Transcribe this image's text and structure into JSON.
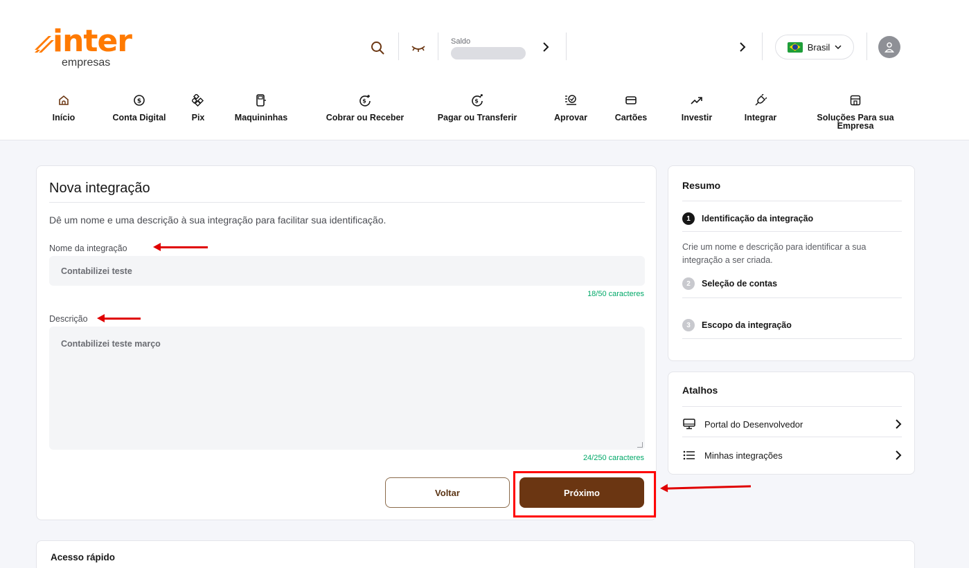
{
  "brand": {
    "name": "inter",
    "sub": "empresas",
    "color": "#ff7a00"
  },
  "topbar": {
    "saldo_label": "Saldo",
    "country": "Brasil"
  },
  "nav": [
    {
      "label": "Início",
      "icon": "home-icon"
    },
    {
      "label": "Conta Digital",
      "icon": "dollar-circle-icon"
    },
    {
      "label": "Pix",
      "icon": "pix-icon"
    },
    {
      "label": "Maquininhas",
      "icon": "card-machine-icon"
    },
    {
      "label": "Cobrar ou Receber",
      "icon": "receive-money-icon"
    },
    {
      "label": "Pagar ou Transferir",
      "icon": "pay-money-icon"
    },
    {
      "label": "Aprovar",
      "icon": "approve-icon"
    },
    {
      "label": "Cartões",
      "icon": "card-icon"
    },
    {
      "label": "Investir",
      "icon": "trend-up-icon"
    },
    {
      "label": "Integrar",
      "icon": "plug-icon"
    },
    {
      "label": "Soluções Para sua Empresa",
      "icon": "store-icon"
    }
  ],
  "form": {
    "title": "Nova integração",
    "intro": "Dê um nome e uma descrição à sua integração para facilitar sua identificação.",
    "name_label": "Nome da integração",
    "name_value": "Contabilizei teste",
    "name_counter": "18/50 caracteres",
    "desc_label": "Descrição",
    "desc_value": "Contabilizei teste março",
    "desc_counter": "24/250 caracteres",
    "back_label": "Voltar",
    "next_label": "Próximo"
  },
  "resumo": {
    "title": "Resumo",
    "steps": [
      {
        "num": "1",
        "label": "Identificação da integração"
      },
      {
        "num": "2",
        "label": "Seleção de contas"
      },
      {
        "num": "3",
        "label": "Escopo da integração"
      }
    ],
    "step1_desc": "Crie um nome e descrição para identificar a sua integração a ser criada."
  },
  "atalhos": {
    "title": "Atalhos",
    "items": [
      {
        "label": "Portal do Desenvolvedor",
        "icon": "monitor-icon"
      },
      {
        "label": "Minhas integrações",
        "icon": "list-icon"
      }
    ]
  },
  "acesso": {
    "title": "Acesso rápido"
  },
  "colors": {
    "primary_brown": "#6b3612",
    "success_green": "#00a868",
    "annotation_red": "#e00000"
  }
}
